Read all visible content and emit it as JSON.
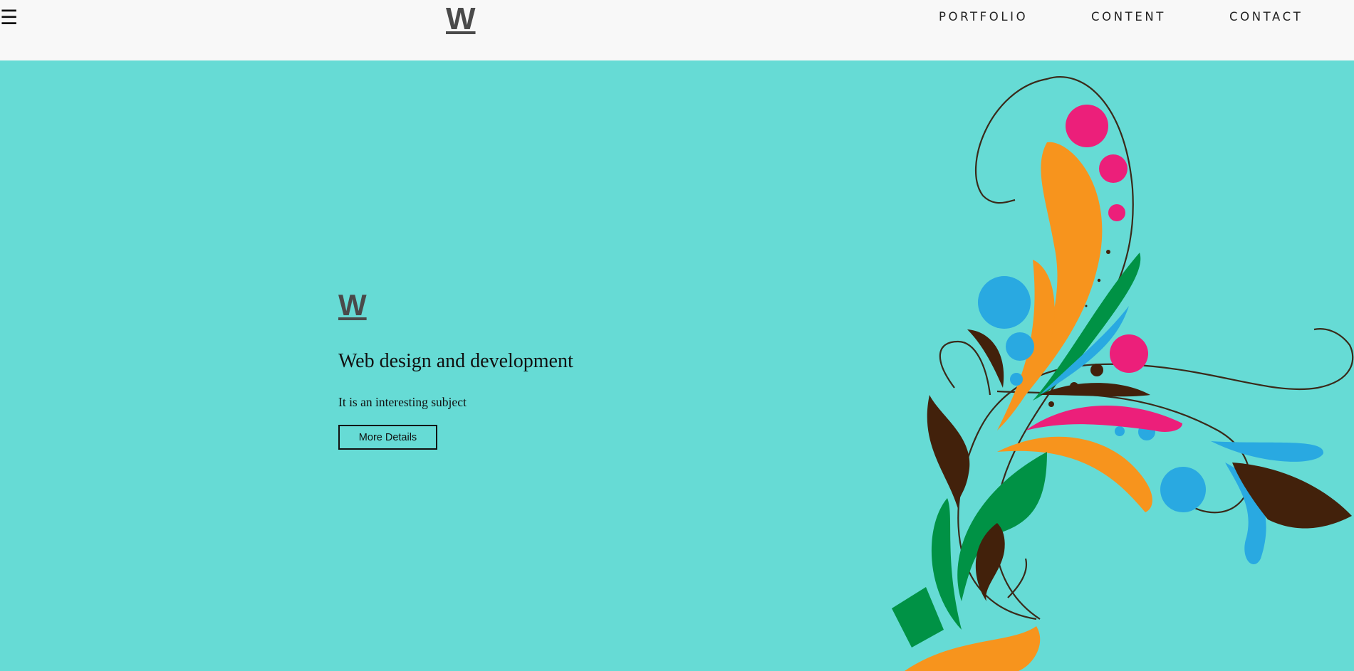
{
  "header": {
    "menu_icon": "hamburger-menu-icon",
    "logo": "W",
    "nav": [
      "PORTFOLIO",
      "CONTENT",
      "CONTACT"
    ]
  },
  "hero": {
    "logo": "W",
    "title": "Web design and development",
    "subtitle": "It is an interesting subject",
    "button_label": "More Details"
  },
  "colors": {
    "header_bg": "#f8f8f8",
    "hero_bg": "#66dbd5",
    "logo": "#4a4a4a",
    "swirl_pink": "#ec1f7a",
    "swirl_orange": "#f7941d",
    "swirl_green": "#009245",
    "swirl_blue": "#29a9e1",
    "swirl_brown": "#42210b"
  }
}
